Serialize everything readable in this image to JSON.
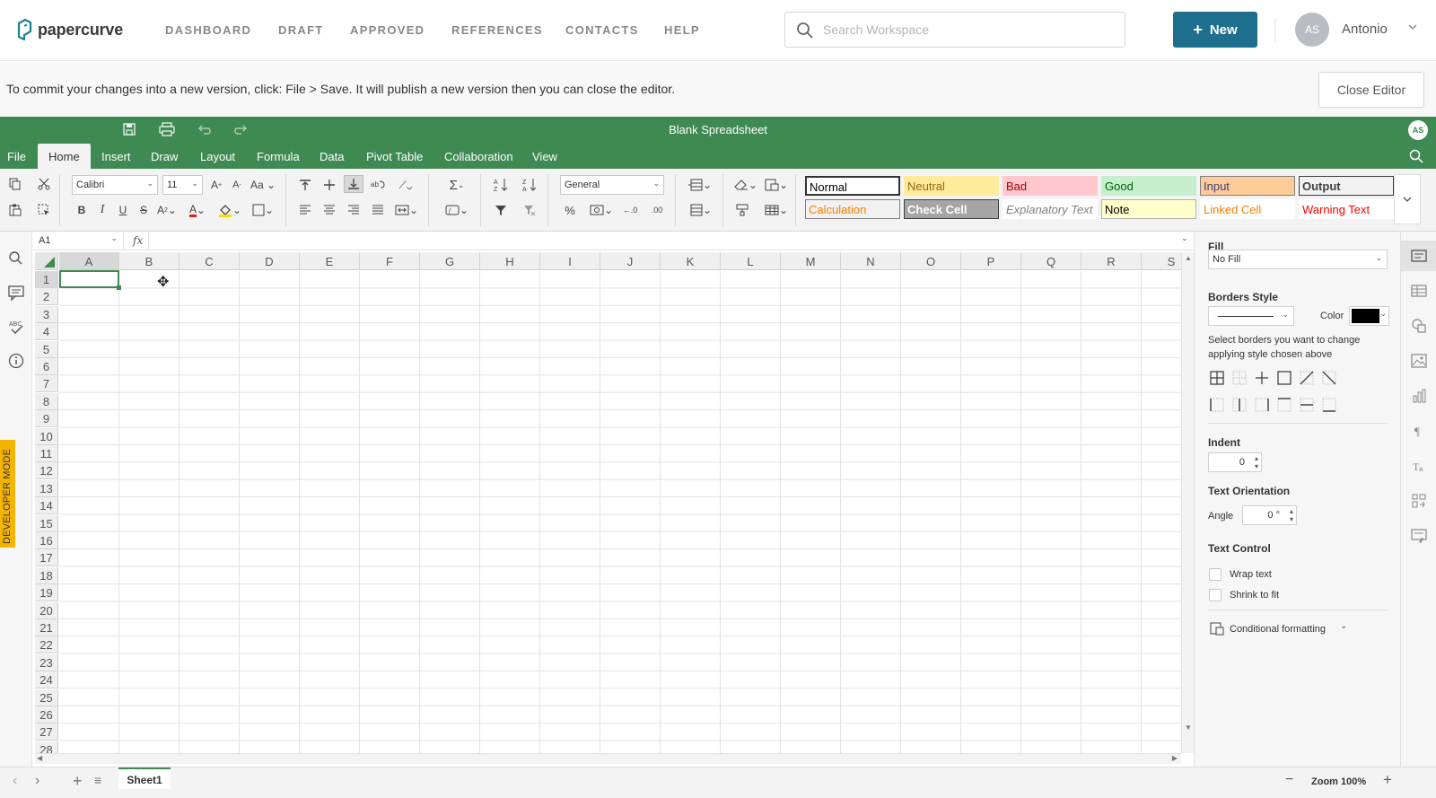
{
  "app": {
    "logo_text": "papercurve",
    "nav": [
      "DASHBOARD",
      "DRAFT",
      "APPROVED",
      "REFERENCES",
      "CONTACTS",
      "HELP"
    ],
    "search_placeholder": "Search Workspace",
    "new_button": "New",
    "avatar_initials": "AS",
    "user_name": "Antonio",
    "brand_color": "#1e6f8d"
  },
  "infobar": {
    "message": "To commit your changes into a new version, click: File > Save. It will publish a new version then you can close the editor.",
    "close_button": "Close Editor"
  },
  "spreadsheet": {
    "title": "Blank Spreadsheet",
    "title_avatar": "AS",
    "theme_color": "#3f8a53",
    "menu_tabs": [
      "File",
      "Home",
      "Insert",
      "Draw",
      "Layout",
      "Formula",
      "Data",
      "Pivot Table",
      "Collaboration",
      "View"
    ],
    "active_tab": "Home",
    "ribbon": {
      "font_name": "Calibri",
      "font_size": "11",
      "number_format": "General",
      "cell_styles": [
        {
          "label": "Normal",
          "bg": "#ffffff",
          "fg": "#000000",
          "border": "#333333"
        },
        {
          "label": "Neutral",
          "bg": "#ffeb9c",
          "fg": "#9c6500",
          "border": "#ffeb9c"
        },
        {
          "label": "Bad",
          "bg": "#ffc7ce",
          "fg": "#9c0006",
          "border": "#ffc7ce"
        },
        {
          "label": "Good",
          "bg": "#c6efce",
          "fg": "#006100",
          "border": "#c6efce"
        },
        {
          "label": "Input",
          "bg": "#ffcc99",
          "fg": "#3f3f76",
          "border": "#7f7f7f"
        },
        {
          "label": "Output",
          "bg": "#f2f2f2",
          "fg": "#3f3f3f",
          "border": "#3f3f3f"
        },
        {
          "label": "Calculation",
          "bg": "#f2f2f2",
          "fg": "#fa7d00",
          "border": "#7f7f7f"
        },
        {
          "label": "Check Cell",
          "bg": "#a5a5a5",
          "fg": "#ffffff",
          "border": "#3f3f3f"
        },
        {
          "label": "Explanatory Text",
          "bg": "#ffffff",
          "fg": "#7f7f7f",
          "border": "#ffffff"
        },
        {
          "label": "Note",
          "bg": "#ffffcc",
          "fg": "#000000",
          "border": "#b2b2b2"
        },
        {
          "label": "Linked Cell",
          "bg": "#ffffff",
          "fg": "#fa7d00",
          "border": "#ffffff"
        },
        {
          "label": "Warning Text",
          "bg": "#ffffff",
          "fg": "#ff0000",
          "border": "#ffffff"
        }
      ]
    },
    "name_box": "A1",
    "fx_label": "fx",
    "columns": [
      "A",
      "B",
      "C",
      "D",
      "E",
      "F",
      "G",
      "H",
      "I",
      "J",
      "K",
      "L",
      "M",
      "N",
      "O",
      "P",
      "Q",
      "R",
      "S"
    ],
    "rows": [
      "1",
      "2",
      "3",
      "4",
      "5",
      "6",
      "7",
      "8",
      "9",
      "10",
      "11",
      "12",
      "13",
      "14",
      "15",
      "16",
      "17",
      "18",
      "19",
      "20",
      "21",
      "22",
      "23",
      "24",
      "25",
      "26",
      "27",
      "28"
    ],
    "active_cell": "A1",
    "developer_mode": "DEVELOPER MODE",
    "sheet_tab": "Sheet1",
    "zoom_label": "Zoom 100%"
  },
  "panel": {
    "fill_label": "Fill",
    "fill_value": "No Fill",
    "borders_label": "Borders Style",
    "color_label": "Color",
    "border_color": "#000000",
    "borders_hint": "Select borders you want to change applying style chosen above",
    "indent_label": "Indent",
    "indent_value": "0",
    "orientation_label": "Text Orientation",
    "angle_label": "Angle",
    "angle_value": "0 °",
    "text_control_label": "Text Control",
    "wrap_text": "Wrap text",
    "shrink_to_fit": "Shrink to fit",
    "conditional_formatting": "Conditional formatting"
  }
}
